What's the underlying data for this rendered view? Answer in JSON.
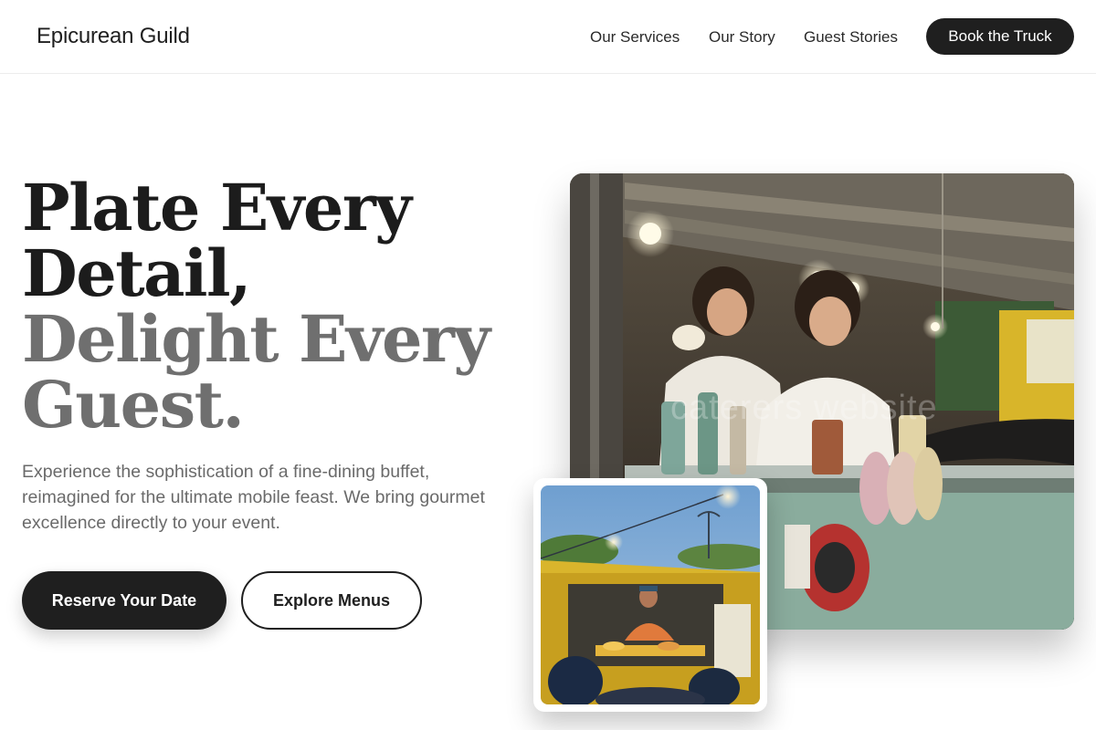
{
  "header": {
    "brand": "Epicurean Guild",
    "nav": {
      "services": "Our Services",
      "story": "Our Story",
      "guests": "Guest Stories"
    },
    "cta": "Book the Truck"
  },
  "hero": {
    "headline_line1": "Plate Every",
    "headline_line2": "Detail,",
    "headline_line3": "Delight Every",
    "headline_line4": "Guest.",
    "subtext": "Experience the sophistication of a fine-dining buffet, reimagined for the ultimate mobile feast. We bring gourmet excellence directly to your event.",
    "primary_button": "Reserve Your Date",
    "secondary_button": "Explore Menus"
  },
  "images": {
    "main_watermark": "caterers website"
  },
  "colors": {
    "dark": "#1f1f1f",
    "muted_headline": "#6f6f6f",
    "body_text": "#6a6a6a",
    "background": "#ffffff"
  }
}
